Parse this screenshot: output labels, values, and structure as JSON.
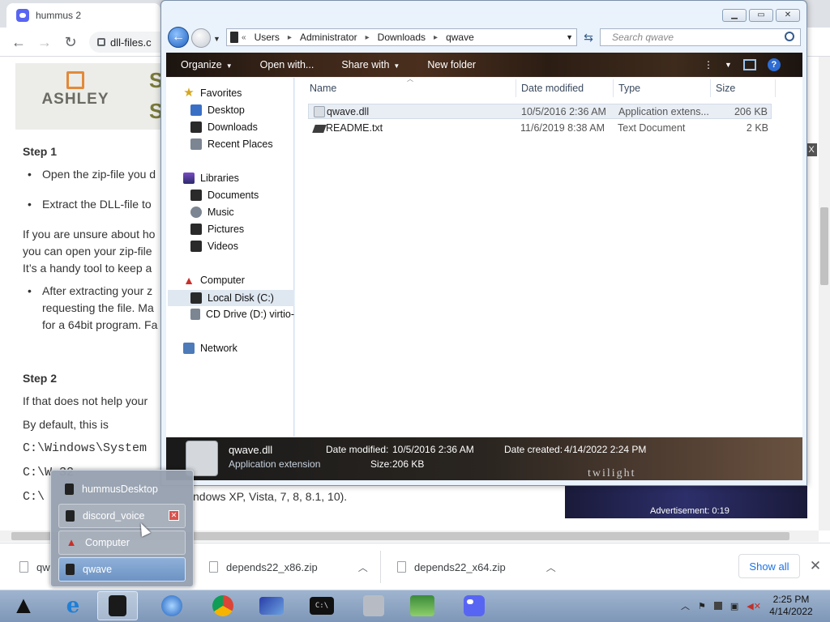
{
  "browser": {
    "tab_title": "hummus 2",
    "omnibox_text": "dll-files.c"
  },
  "webpage": {
    "ad_brand": "ASHLEY",
    "ad_side_letters": "S\nS",
    "step1_heading": "Step 1",
    "step1_bullet1": "Open the zip-file you d",
    "step1_bullet2": "Extract the DLL-file to",
    "para1_line1": "If you are unsure about ho",
    "para1_line2": "you can open your zip-file",
    "para1_line3": "It’s a handy tool to keep a",
    "bullet3_line1": "After extracting your z",
    "bullet3_line2": "requesting the file. Ma",
    "bullet3_line3": "for a 64bit program. Fa",
    "step2_heading": "Step 2",
    "step2_line1": "If that does not help your",
    "step2_line2": "By default, this is",
    "code_line1": "C:\\Windows\\System",
    "code_line2": "C:\\W              32",
    "code_line3": "C:\\",
    "windows_versions_text": "ndows XP, Vista, 7, 8, 8.1, 10).",
    "ad_bottom_text": "Advertisement: 0:19",
    "ad_close_glyph": "X"
  },
  "download_shelf": {
    "items": [
      {
        "name": "qw"
      },
      {
        "name": "depends22_x86.zip"
      },
      {
        "name": "depends22_x64.zip"
      }
    ],
    "show_all": "Show all"
  },
  "explorer": {
    "breadcrumb": [
      "Users",
      "Administrator",
      "Downloads",
      "qwave"
    ],
    "search_placeholder": "Search qwave",
    "commands": [
      "Organize",
      "Open with...",
      "Share with",
      "New folder"
    ],
    "nav": {
      "favorites": "Favorites",
      "desktop": "Desktop",
      "downloads": "Downloads",
      "recent": "Recent Places",
      "libraries": "Libraries",
      "documents": "Documents",
      "music": "Music",
      "pictures": "Pictures",
      "videos": "Videos",
      "computer": "Computer",
      "local_disk": "Local Disk (C:)",
      "cd_drive": "CD Drive (D:) virtio-",
      "network": "Network"
    },
    "columns": [
      "Name",
      "Date modified",
      "Type",
      "Size"
    ],
    "files": [
      {
        "name": "qwave.dll",
        "date": "10/5/2016 2:36 AM",
        "type": "Application extens...",
        "size": "206 KB"
      },
      {
        "name": "README.txt",
        "date": "11/6/2019 8:38 AM",
        "type": "Text Document",
        "size": "2 KB"
      }
    ],
    "details": {
      "name": "qwave.dll",
      "kind": "Application extension",
      "date_modified_label": "Date modified:",
      "date_modified": "10/5/2016 2:36 AM",
      "date_created_label": "Date created:",
      "date_created": "4/14/2022 2:24 PM",
      "size_label": "Size:",
      "size": "206 KB",
      "theme_text": "twilight"
    }
  },
  "jump_list": {
    "items": [
      "hummusDesktop",
      "discord_voice",
      "Computer",
      "qwave"
    ]
  },
  "taskbar": {
    "time": "2:25 PM",
    "date": "4/14/2022",
    "cmd_label": "C:\\"
  }
}
